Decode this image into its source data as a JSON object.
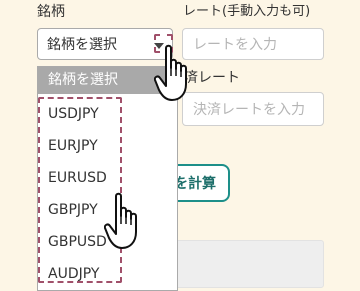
{
  "form": {
    "symbol_label": "銘柄",
    "rate_label": "レート(手動入力も可)",
    "rate_placeholder": "レートを入力",
    "settle_label_visible": "済レート",
    "settle_placeholder": "決済レートを入力",
    "calc_button_visible": "を計算"
  },
  "symbol_select": {
    "selected": "銘柄を選択",
    "options": [
      "USDJPY",
      "EURJPY",
      "EURUSD",
      "GBPJPY",
      "GBPUSD",
      "AUDJPY"
    ]
  },
  "icons": {
    "dropdown_arrow": "triangle-down",
    "cursor_1": "hand-pointer",
    "cursor_2": "hand-pointer"
  },
  "colors": {
    "page_bg": "#fdf6e6",
    "accent": "#1d8f89",
    "highlight_dash": "#a0506a",
    "dropdown_header": "#a9a9a9"
  }
}
